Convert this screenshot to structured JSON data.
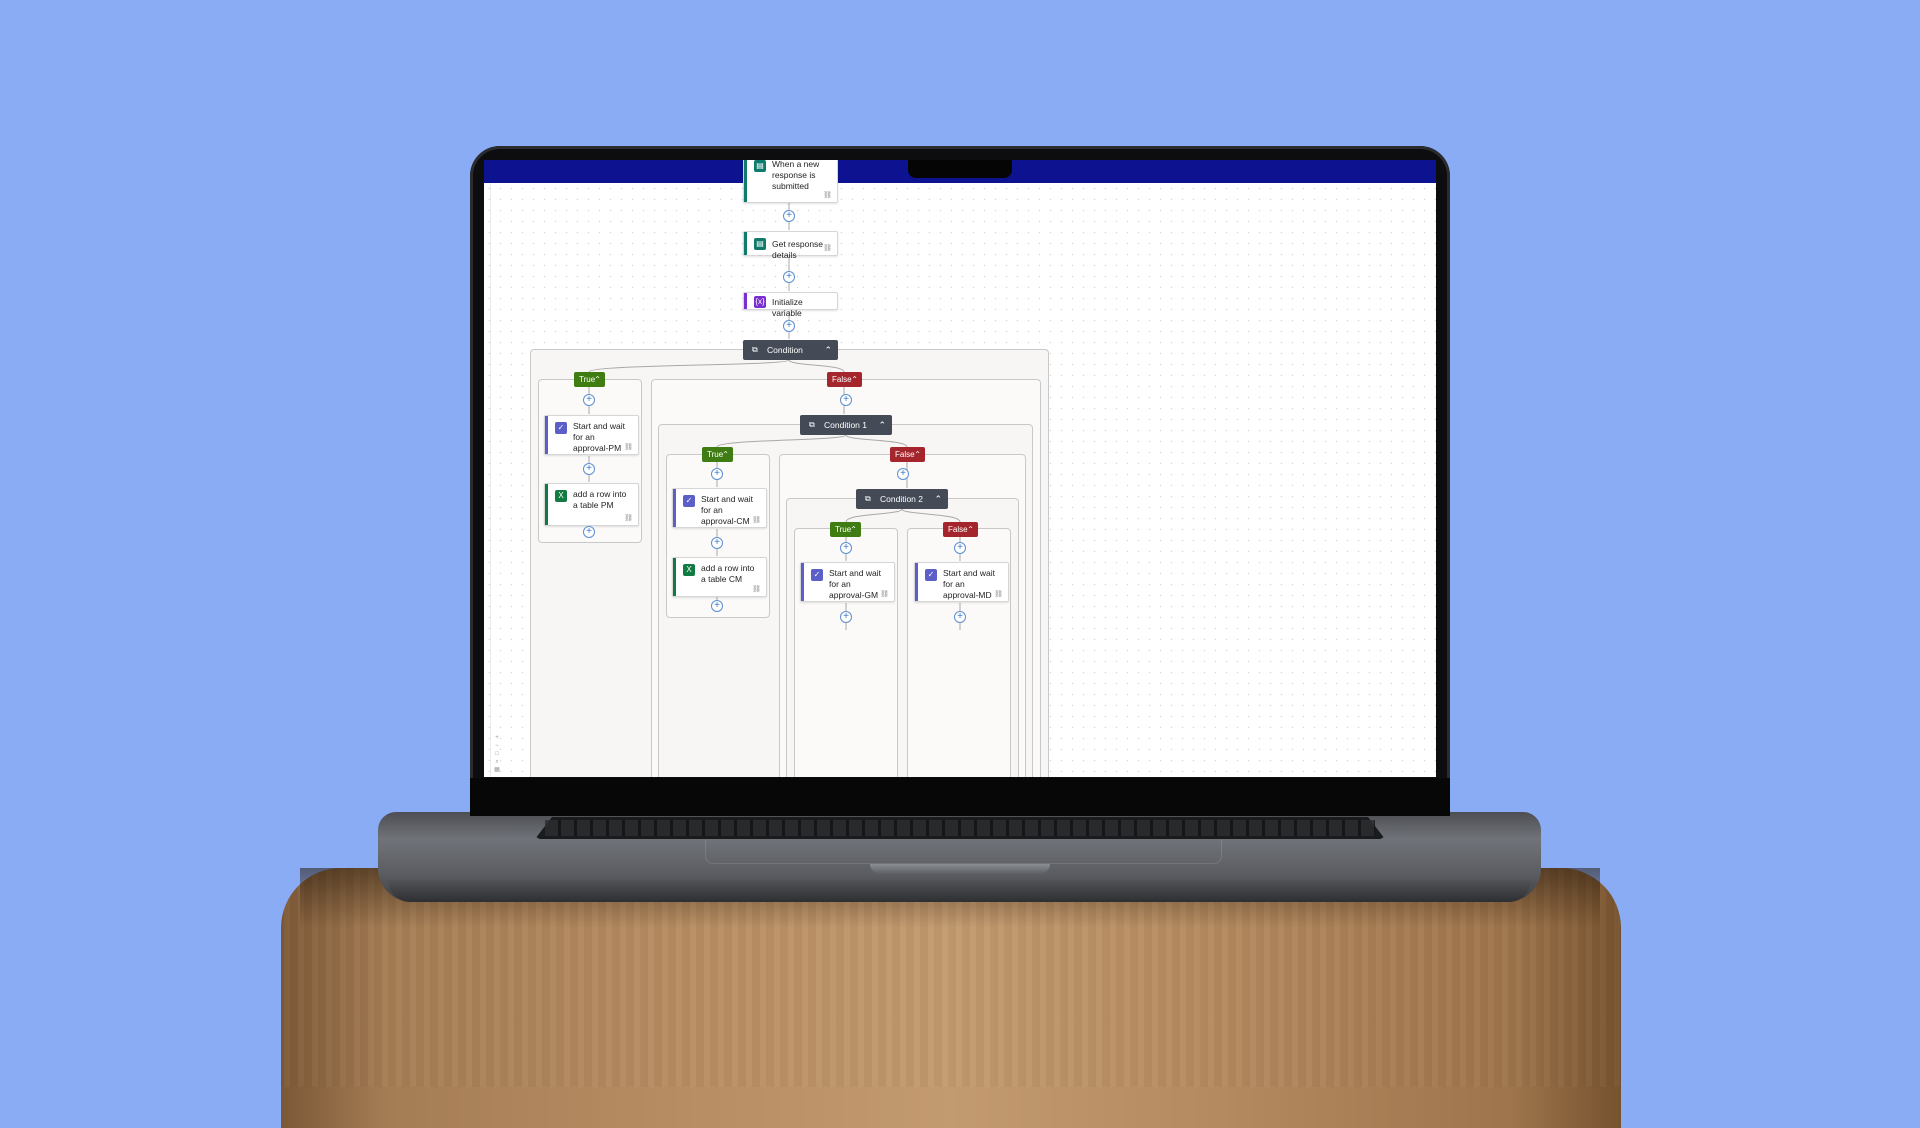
{
  "colors": {
    "background": "#89acf5",
    "titlebar": "#0d1390",
    "true_branch": "#3f7d13",
    "false_branch": "#a4262c",
    "condition_header": "#444b57",
    "forms_accent": "#0f7b6c",
    "variable_accent": "#7a2fd0",
    "approvals_accent": "#5b5fc7",
    "excel_accent": "#107c41"
  },
  "icons": {
    "forms": "forms-icon",
    "variable": "variable-icon",
    "approvals": "approvals-icon",
    "excel": "excel-icon",
    "condition": "condition-icon",
    "link": "link-icon",
    "plus": "add-step-icon",
    "collapse": "chevron-up-icon"
  },
  "flow": {
    "trigger": {
      "label": "When a new response is submitted"
    },
    "get_details": {
      "label": "Get response details"
    },
    "init_var": {
      "label": "Initialize variable"
    },
    "condition": {
      "label": "Condition"
    },
    "cond1": {
      "label": "Condition 1"
    },
    "cond2": {
      "label": "Condition 2"
    },
    "branches": {
      "true": "True",
      "false": "False"
    },
    "approval_pm": {
      "label": "Start and wait for an approval-PM"
    },
    "row_pm": {
      "label": "add a row into a table PM"
    },
    "approval_cm": {
      "label": "Start and wait for an approval-CM"
    },
    "row_cm": {
      "label": "add a row into a table CM"
    },
    "approval_gm": {
      "label": "Start and wait for an approval-GM"
    },
    "approval_md": {
      "label": "Start and wait for an approval-MD"
    },
    "add_symbol": "+",
    "link_symbol": "⛓"
  }
}
